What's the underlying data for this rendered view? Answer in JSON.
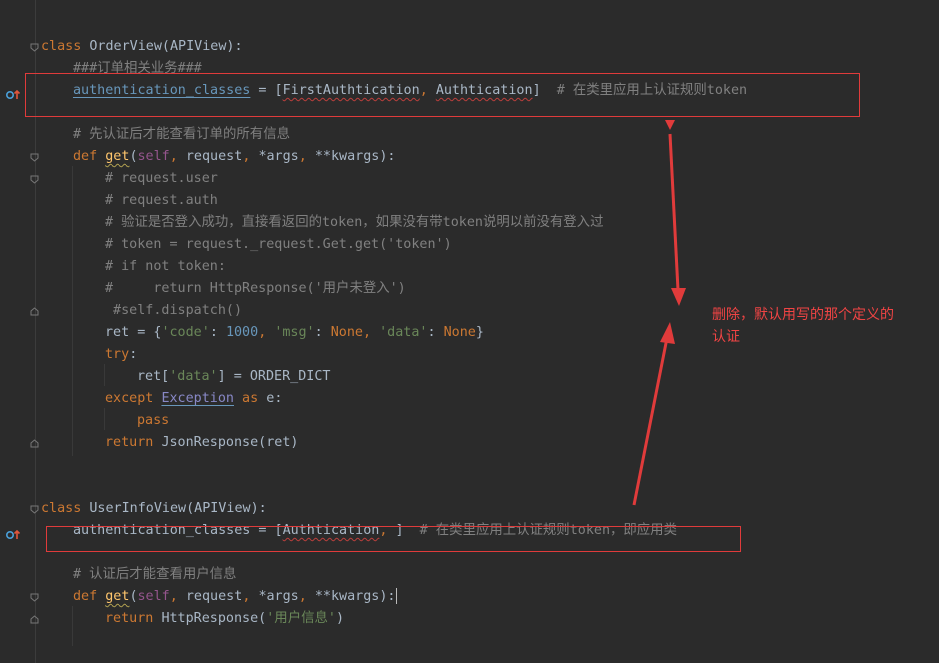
{
  "code_lines": [
    {
      "key": "l1",
      "segments": [
        [
          "kw",
          "class "
        ],
        [
          "cls",
          "OrderView(APIView):"
        ]
      ]
    },
    {
      "key": "l2",
      "segments": [
        [
          "cmt",
          "###订单相关业务###"
        ]
      ]
    },
    {
      "key": "l3",
      "segments": [
        [
          "field-blue link",
          "authentication_classes"
        ],
        [
          "plain",
          " = ["
        ],
        [
          "cls err",
          "FirstAuthtication"
        ],
        [
          "kw",
          ", "
        ],
        [
          "cls err",
          "Authtication"
        ],
        [
          "plain",
          "]  "
        ],
        [
          "cmt",
          "# 在类里应用上认证规则token"
        ]
      ]
    },
    {
      "key": "l4",
      "segments": [
        [
          "cmt",
          "# 先认证后才能查看订单的所有信息"
        ]
      ]
    },
    {
      "key": "l5",
      "segments": [
        [
          "kw",
          "def "
        ],
        [
          "fn warn",
          "get"
        ],
        [
          "plain",
          "("
        ],
        [
          "self",
          "self"
        ],
        [
          "kw",
          ", "
        ],
        [
          "param",
          "request"
        ],
        [
          "kw",
          ", "
        ],
        [
          "plain",
          "*args"
        ],
        [
          "kw",
          ", "
        ],
        [
          "plain",
          "**kwargs):"
        ]
      ]
    },
    {
      "key": "l6",
      "segments": [
        [
          "cmt",
          "# request.user"
        ]
      ]
    },
    {
      "key": "l7",
      "segments": [
        [
          "cmt",
          "# request.auth"
        ]
      ]
    },
    {
      "key": "l8",
      "segments": [
        [
          "cmt",
          "# 验证是否登入成功，直接看返回的token，如果没有带token说明以前没有登入过"
        ]
      ]
    },
    {
      "key": "l9",
      "segments": [
        [
          "cmt",
          "# token = request._request.Get.get('token')"
        ]
      ]
    },
    {
      "key": "l10",
      "segments": [
        [
          "cmt",
          "# if not token:"
        ]
      ]
    },
    {
      "key": "l11",
      "segments": [
        [
          "cmt",
          "#     return HttpResponse('用户未登入')"
        ]
      ]
    },
    {
      "key": "l12",
      "segments": [
        [
          "cmt",
          " #self.dispatch()"
        ]
      ]
    },
    {
      "key": "l13",
      "segments": [
        [
          "plain",
          "ret = {"
        ],
        [
          "str",
          "'code'"
        ],
        [
          "plain",
          ": "
        ],
        [
          "num",
          "1000"
        ],
        [
          "kw",
          ", "
        ],
        [
          "str",
          "'msg'"
        ],
        [
          "plain",
          ": "
        ],
        [
          "kw",
          "None"
        ],
        [
          "kw",
          ", "
        ],
        [
          "str",
          "'data'"
        ],
        [
          "plain",
          ": "
        ],
        [
          "kw",
          "None"
        ],
        [
          "plain",
          "}"
        ]
      ]
    },
    {
      "key": "l14",
      "segments": [
        [
          "kw",
          "try"
        ],
        [
          "plain",
          ":"
        ]
      ]
    },
    {
      "key": "l15",
      "segments": [
        [
          "plain",
          "ret["
        ],
        [
          "str",
          "'data'"
        ],
        [
          "plain",
          "] = ORDER_DICT"
        ]
      ]
    },
    {
      "key": "l16",
      "segments": [
        [
          "kw",
          "except "
        ],
        [
          "builtin link",
          "Exception"
        ],
        [
          "kw",
          " as "
        ],
        [
          "var-e",
          "e"
        ],
        [
          "plain",
          ":"
        ]
      ]
    },
    {
      "key": "l17",
      "segments": [
        [
          "kw",
          "pass"
        ]
      ]
    },
    {
      "key": "l18",
      "segments": [
        [
          "kw",
          "return "
        ],
        [
          "plain",
          "JsonResponse(ret)"
        ]
      ]
    },
    {
      "key": "l19",
      "segments": [
        [
          "kw",
          "class "
        ],
        [
          "cls",
          "UserInfoView(APIView):"
        ]
      ]
    },
    {
      "key": "l20",
      "segments": [
        [
          "plain",
          "authentication_classes = ["
        ],
        [
          "cls err",
          "Authtication"
        ],
        [
          "kw",
          ", "
        ],
        [
          "plain",
          "]  "
        ],
        [
          "cmt",
          "# 在类里应用上认证规则token，即应用类"
        ]
      ]
    },
    {
      "key": "l21",
      "segments": [
        [
          "cmt",
          "# 认证后才能查看用户信息"
        ]
      ]
    },
    {
      "key": "l22",
      "segments": [
        [
          "kw",
          "def "
        ],
        [
          "fn warn",
          "get"
        ],
        [
          "plain",
          "("
        ],
        [
          "self",
          "self"
        ],
        [
          "kw",
          ", "
        ],
        [
          "param",
          "request"
        ],
        [
          "kw",
          ", "
        ],
        [
          "plain",
          "*args"
        ],
        [
          "kw",
          ", "
        ],
        [
          "plain",
          "**kwargs):"
        ]
      ]
    },
    {
      "key": "l23",
      "segments": [
        [
          "kw",
          "return "
        ],
        [
          "plain",
          "HttpResponse("
        ],
        [
          "str",
          "'用户信息'"
        ],
        [
          "plain",
          ")"
        ]
      ]
    }
  ],
  "annotation": {
    "line1": "删除，默认用写的那个定义的",
    "line2": "认证"
  },
  "colors": {
    "background": "#2b2b2b",
    "keyword": "#cc7832",
    "comment": "#808080",
    "string": "#6a8759",
    "annotation_red": "#f04444"
  },
  "icons": {
    "gutter_override": "override-up-arrow-icon",
    "fold": "fold-marker-icon"
  }
}
